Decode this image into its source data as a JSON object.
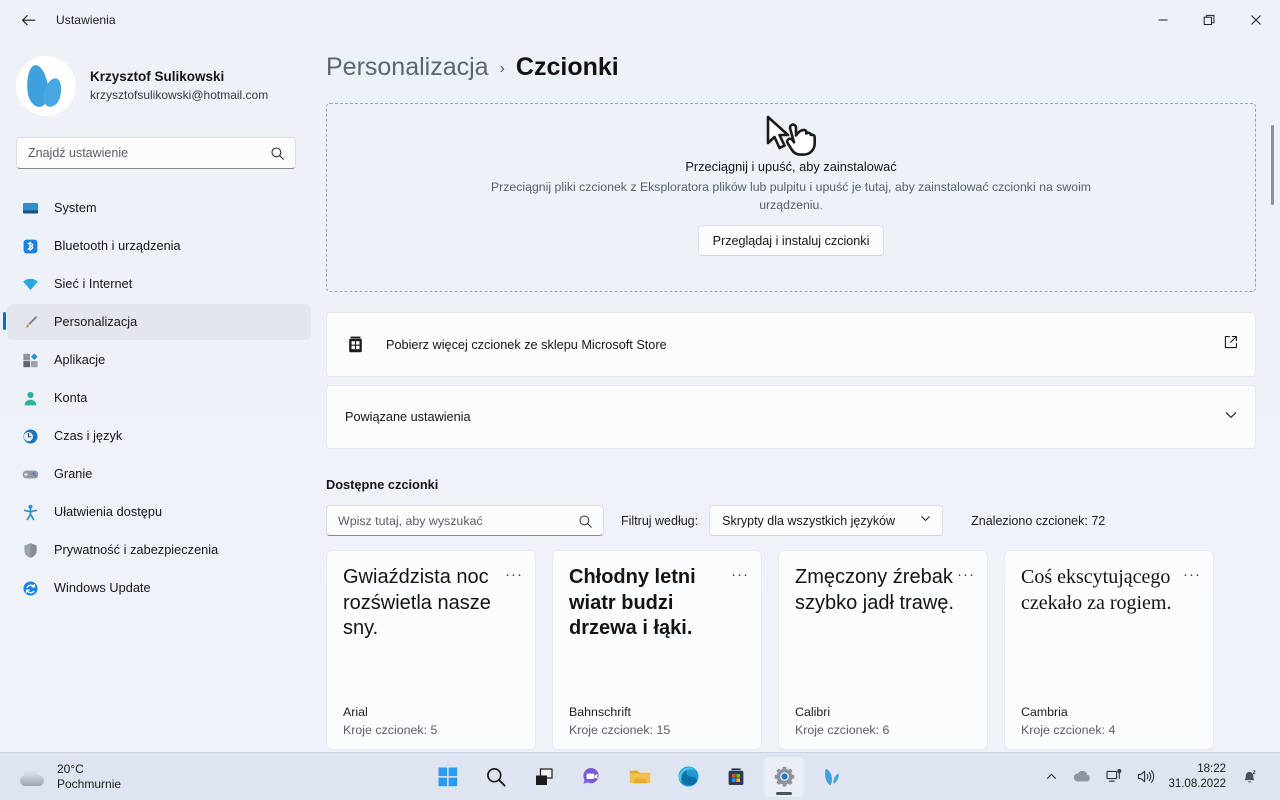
{
  "window": {
    "title": "Ustawienia",
    "back_icon": "back-arrow-icon",
    "minimize": "–",
    "maximize": "❐",
    "close": "✕"
  },
  "account": {
    "name": "Krzysztof Sulikowski",
    "email": "krzysztofsulikowski@hotmail.com"
  },
  "search": {
    "placeholder": "Znajdź ustawienie"
  },
  "sidebar": {
    "items": [
      {
        "label": "System",
        "icon": "monitor-icon",
        "selected": false
      },
      {
        "label": "Bluetooth i urządzenia",
        "icon": "bluetooth-icon",
        "selected": false
      },
      {
        "label": "Sieć i Internet",
        "icon": "wifi-icon",
        "selected": false
      },
      {
        "label": "Personalizacja",
        "icon": "paintbrush-icon",
        "selected": true
      },
      {
        "label": "Aplikacje",
        "icon": "apps-icon",
        "selected": false
      },
      {
        "label": "Konta",
        "icon": "person-icon",
        "selected": false
      },
      {
        "label": "Czas i język",
        "icon": "clock-globe-icon",
        "selected": false
      },
      {
        "label": "Granie",
        "icon": "gamepad-icon",
        "selected": false
      },
      {
        "label": "Ułatwienia dostępu",
        "icon": "accessibility-icon",
        "selected": false
      },
      {
        "label": "Prywatność i zabezpieczenia",
        "icon": "shield-icon",
        "selected": false
      },
      {
        "label": "Windows Update",
        "icon": "update-icon",
        "selected": false
      }
    ]
  },
  "breadcrumb": {
    "parent": "Personalizacja",
    "separator": "›",
    "current": "Czcionki"
  },
  "dropzone": {
    "icon": "drag-drop-cursor-icon",
    "title": "Przeciągnij i upuść, aby zainstalować",
    "subtitle": "Przeciągnij pliki czcionek z Eksploratora plików lub pulpitu i upuść je tutaj, aby zainstalować czcionki na swoim urządzeniu.",
    "button": "Przeglądaj i instaluj czcionki"
  },
  "store_card": {
    "icon": "microsoft-store-icon",
    "label": "Pobierz więcej czcionek ze sklepu Microsoft Store",
    "action_icon": "external-link-icon"
  },
  "related_card": {
    "label": "Powiązane ustawienia",
    "action_icon": "chevron-down-icon"
  },
  "fonts_section": {
    "title": "Dostępne czcionki",
    "search_placeholder": "Wpisz tutaj, aby wyszukać",
    "filter_label": "Filtruj według:",
    "filter_value": "Skrypty dla wszystkich języków",
    "found": "Znaleziono czcionek: 72",
    "faces_prefix": "Kroje czcionek:",
    "cards": [
      {
        "sample": "Gwiaździsta noc rozświetla nasze sny.",
        "name": "Arial",
        "faces": "Kroje czcionek: 5",
        "style": "f-sans"
      },
      {
        "sample": "Chłodny letni wiatr budzi drzewa i łąki.",
        "name": "Bahnschrift",
        "faces": "Kroje czcionek: 15",
        "style": "f-narrow"
      },
      {
        "sample": "Zmęczony źrebak szybko jadł trawę.",
        "name": "Calibri",
        "faces": "Kroje czcionek: 6",
        "style": "f-sans"
      },
      {
        "sample": "Coś ekscytującego czekało za rogiem.",
        "name": "Cambria",
        "faces": "Kroje czcionek: 4",
        "style": "f-serif"
      }
    ],
    "overflow_glyph": "···"
  },
  "taskbar": {
    "weather": {
      "temperature": "20°C",
      "condition": "Pochmurnie",
      "icon": "cloud-icon"
    },
    "apps": [
      {
        "name": "start-button",
        "icon": "windows-logo-icon",
        "active": false
      },
      {
        "name": "search-button",
        "icon": "search-icon",
        "active": false
      },
      {
        "name": "task-view-button",
        "icon": "task-view-icon",
        "active": false
      },
      {
        "name": "chat-button",
        "icon": "chat-icon",
        "active": false
      },
      {
        "name": "file-explorer-button",
        "icon": "folder-icon",
        "active": false
      },
      {
        "name": "edge-button",
        "icon": "edge-icon",
        "active": false
      },
      {
        "name": "store-button",
        "icon": "microsoft-store-icon",
        "active": false
      },
      {
        "name": "settings-button",
        "icon": "gear-icon",
        "active": true
      },
      {
        "name": "app-button",
        "icon": "leaf-logo-icon",
        "active": false
      }
    ],
    "tray": {
      "overflow_icon": "chevron-up-icon",
      "onedrive_icon": "cloud-icon",
      "network_icon": "network-icon",
      "volume_icon": "speaker-icon",
      "time": "18:22",
      "date": "31.08.2022",
      "notification_icon": "bell-dnd-icon"
    }
  },
  "colors": {
    "accent": "#0d6cc4",
    "page_bg": "#eef2f9",
    "card_bg": "#fbfcfd",
    "taskbar_bg": "#dfe5f0"
  }
}
